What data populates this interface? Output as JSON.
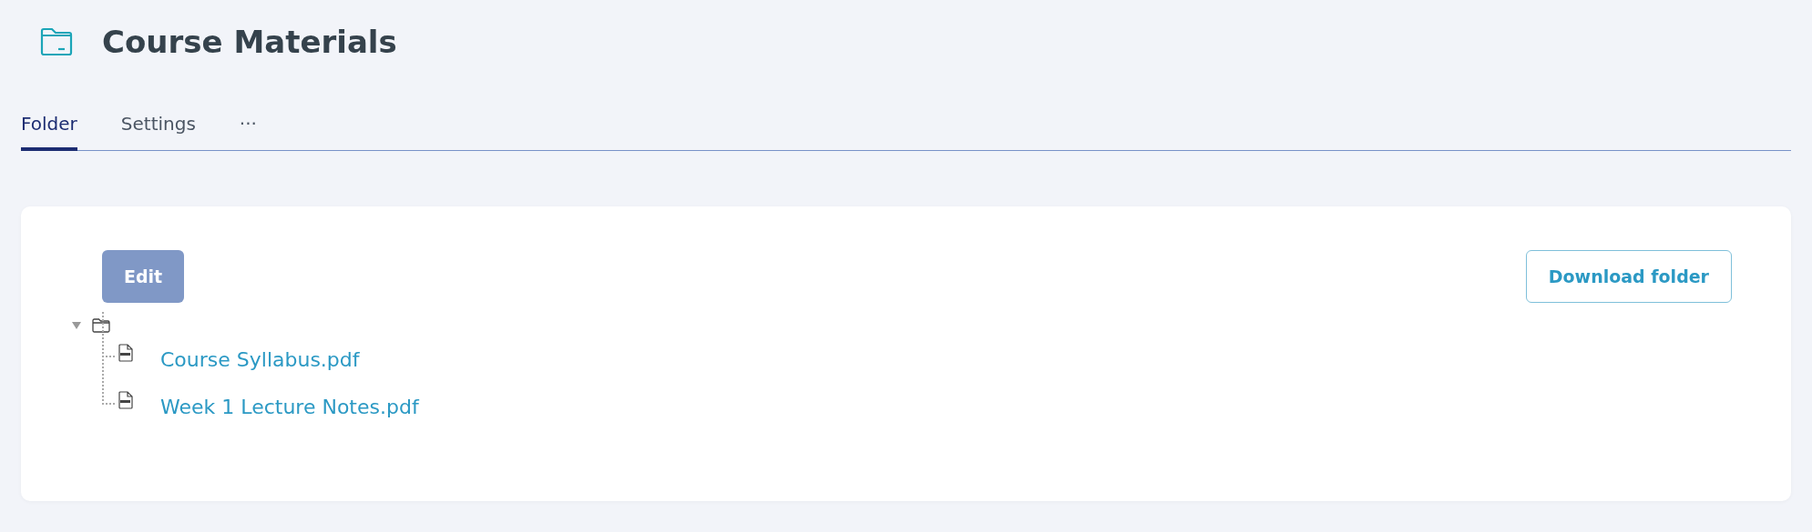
{
  "header": {
    "title": "Course Materials"
  },
  "tabs": [
    {
      "label": "Folder",
      "selected": true
    },
    {
      "label": "Settings",
      "selected": false
    },
    {
      "label": "···",
      "selected": false
    }
  ],
  "toolbar": {
    "edit_button": {
      "label": "Edit",
      "disabled": true
    },
    "download_button": {
      "label": "Download folder"
    }
  },
  "tree": {
    "expanded": true,
    "children": [
      {
        "name": "Course Syllabus.pdf",
        "kind": "pdf"
      },
      {
        "name": "Week 1 Lecture Notes.pdf",
        "kind": "pdf"
      }
    ]
  }
}
